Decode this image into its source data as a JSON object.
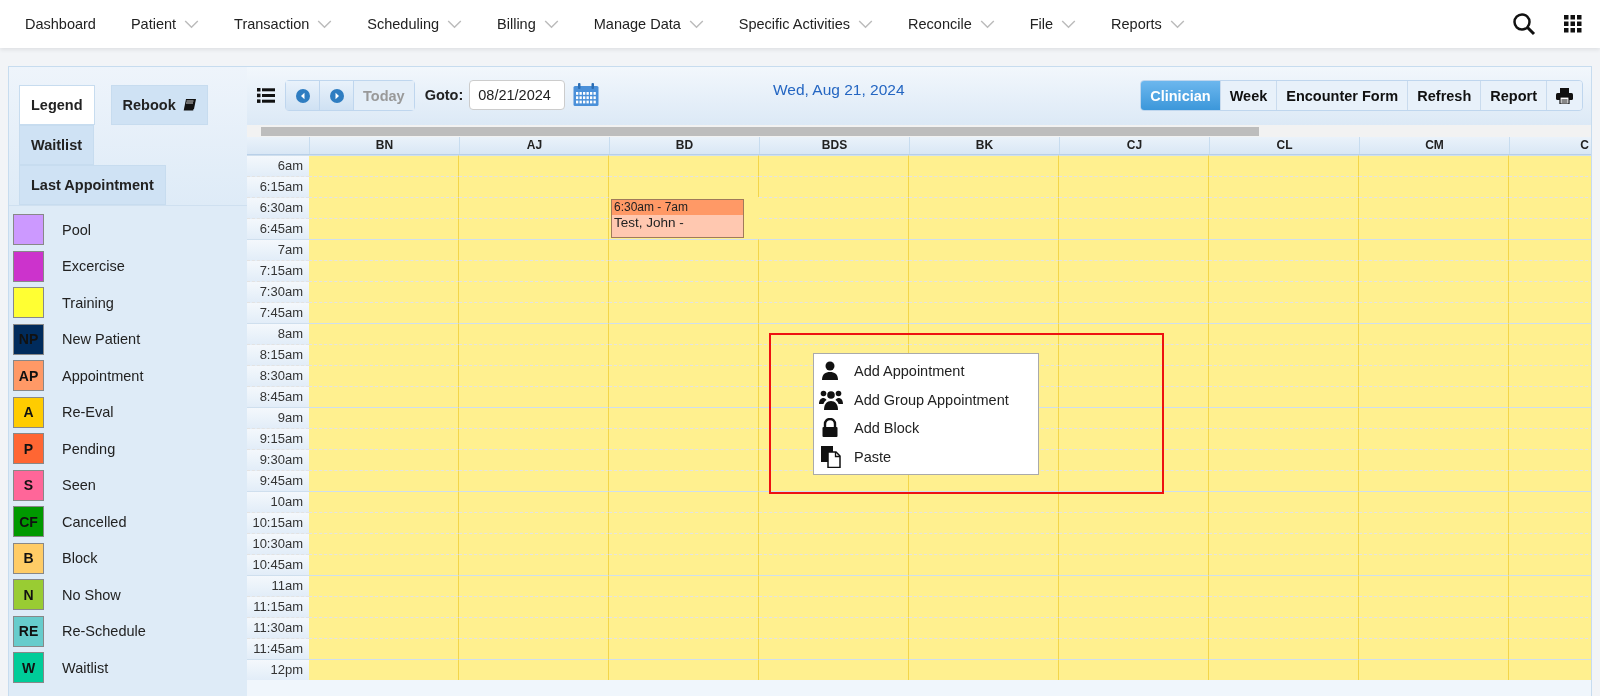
{
  "nav": {
    "items": [
      {
        "label": "Dashboard",
        "has_menu": false
      },
      {
        "label": "Patient",
        "has_menu": true
      },
      {
        "label": "Transaction",
        "has_menu": true
      },
      {
        "label": "Scheduling",
        "has_menu": true
      },
      {
        "label": "Billing",
        "has_menu": true
      },
      {
        "label": "Manage Data",
        "has_menu": true
      },
      {
        "label": "Specific Activities",
        "has_menu": true
      },
      {
        "label": "Reconcile",
        "has_menu": true
      },
      {
        "label": "File",
        "has_menu": true
      },
      {
        "label": "Reports",
        "has_menu": true
      }
    ]
  },
  "sidebar": {
    "tabs": [
      {
        "label": "Legend",
        "selected": true,
        "kind": "plain"
      },
      {
        "label": "Rebook",
        "selected": false,
        "kind": "book"
      },
      {
        "label": "Waitlist",
        "selected": false,
        "kind": "plain"
      },
      {
        "label": "Last Appointment",
        "selected": false,
        "kind": "plain"
      }
    ],
    "legend": [
      {
        "label": "Pool",
        "color": "#cc99ff"
      },
      {
        "label": "Excercise",
        "color": "#cc33cc"
      },
      {
        "label": "Training",
        "color": "#ffff33"
      },
      {
        "code": "NP",
        "label": "New Patient",
        "color": "#002b5c"
      },
      {
        "code": "AP",
        "label": "Appointment",
        "color": "#ff9966"
      },
      {
        "code": "A",
        "label": "Re-Eval",
        "color": "#ffcc00"
      },
      {
        "code": "P",
        "label": "Pending",
        "color": "#ff6633"
      },
      {
        "code": "S",
        "label": "Seen",
        "color": "#ff6699"
      },
      {
        "code": "CF",
        "label": "Cancelled",
        "color": "#009900"
      },
      {
        "code": "B",
        "label": "Block",
        "color": "#ffcc66"
      },
      {
        "code": "N",
        "label": "No Show",
        "color": "#99cc33"
      },
      {
        "code": "RE",
        "label": "Re-Schedule",
        "color": "#66cccc"
      },
      {
        "code": "W",
        "label": "Waitlist",
        "color": "#00cc99"
      }
    ]
  },
  "toolbar": {
    "today": {
      "label": "Today",
      "disabled": true
    },
    "goto_label": "Goto:",
    "goto_date": "08/21/2024",
    "current_date": "Wed, Aug 21, 2024",
    "views": [
      {
        "label": "Clinician",
        "selected": true
      },
      {
        "label": "Week",
        "selected": false
      },
      {
        "label": "Encounter Form",
        "selected": false
      },
      {
        "label": "Refresh",
        "selected": false
      },
      {
        "label": "Report",
        "selected": false
      }
    ]
  },
  "calendar": {
    "columns": [
      "BN",
      "AJ",
      "BD",
      "BDS",
      "BK",
      "CJ",
      "CL",
      "CM",
      "C"
    ],
    "times": [
      "6am",
      "6:15am",
      "6:30am",
      "6:45am",
      "7am",
      "7:15am",
      "7:30am",
      "7:45am",
      "8am",
      "8:15am",
      "8:30am",
      "8:45am",
      "9am",
      "9:15am",
      "9:30am",
      "9:45am",
      "10am",
      "10:15am",
      "10:30am",
      "10:45am",
      "11am",
      "11:15am",
      "11:30am",
      "11:45am",
      "12pm"
    ],
    "appointments": [
      {
        "time": "6:30am - 7am",
        "patient": "Test, John -",
        "color": "#ff9966"
      }
    ]
  },
  "context_menu": {
    "items": [
      {
        "label": "Add Appointment",
        "kind": "person"
      },
      {
        "label": "Add Group Appointment",
        "kind": "group"
      },
      {
        "label": "Add Block",
        "kind": "lock"
      },
      {
        "label": "Paste",
        "kind": "paste"
      }
    ]
  }
}
